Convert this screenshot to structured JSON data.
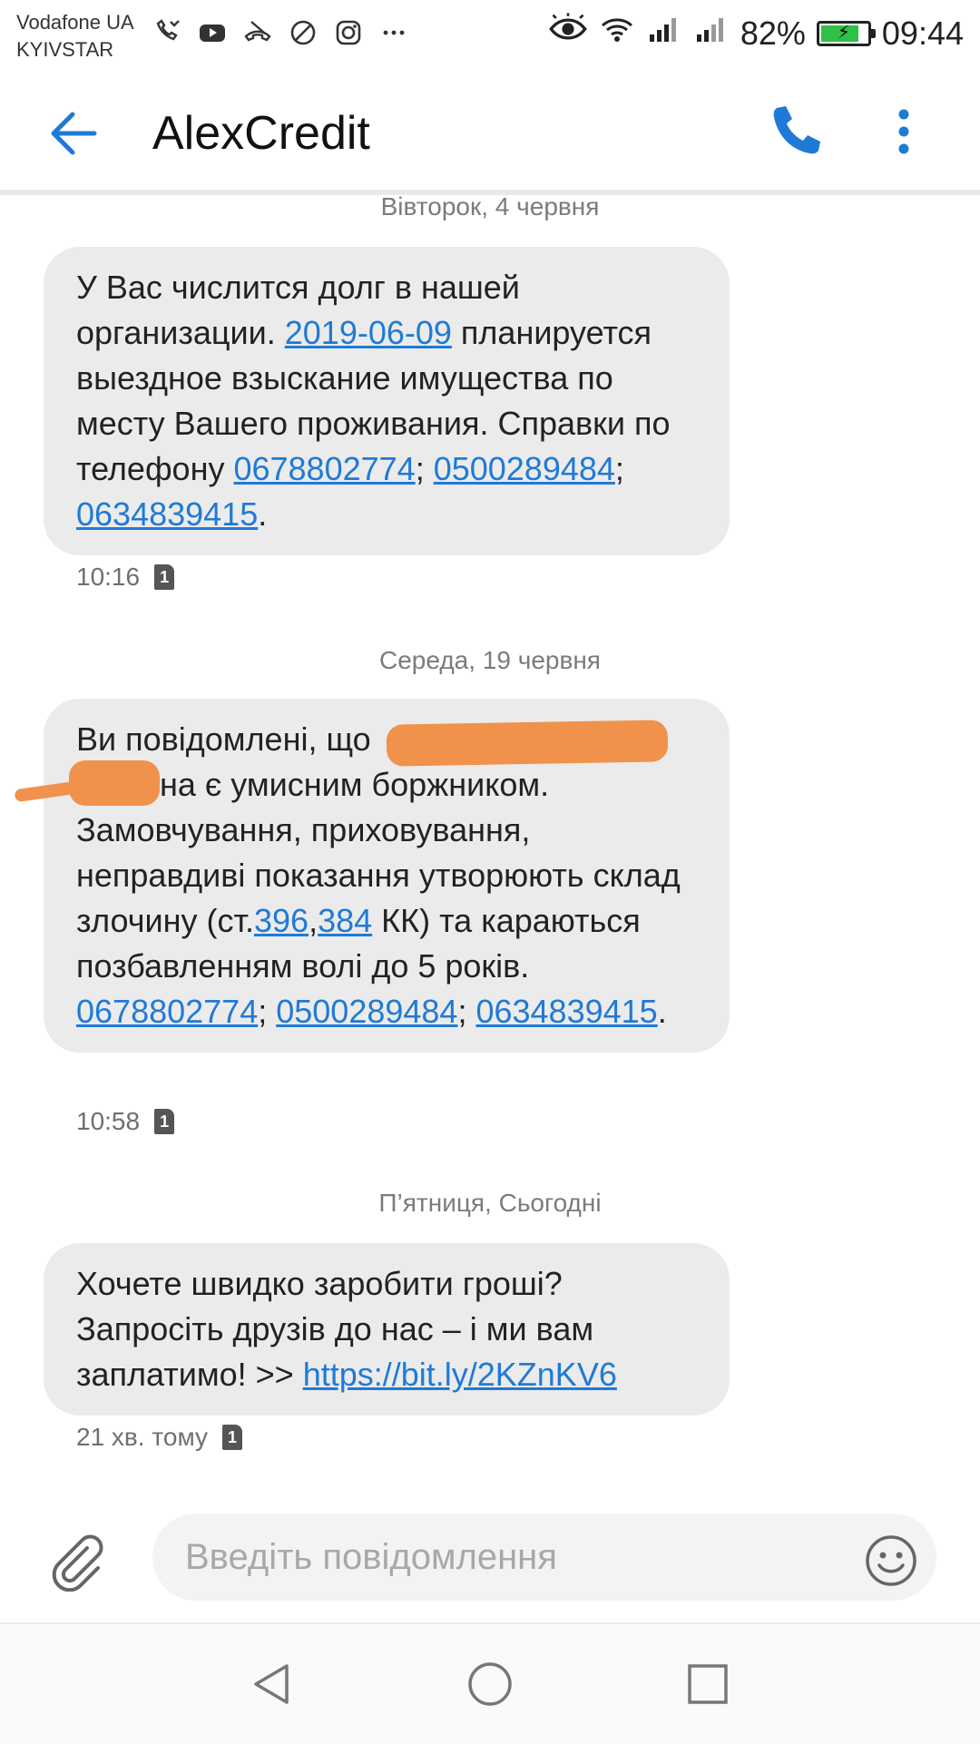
{
  "status_bar": {
    "carrier_1": "Vodafone UA",
    "carrier_2": "KYIVSTAR",
    "icons_left": [
      "missed-call-icon",
      "youtube-icon",
      "call-end-icon",
      "blocked-icon",
      "instagram-icon",
      "more-dots-icon"
    ],
    "icons_right": [
      "eye-icon",
      "wifi-icon",
      "signal-icon",
      "signal-icon"
    ],
    "battery": "82%",
    "battery_level": 0.82,
    "time": "09:44"
  },
  "header": {
    "title": "AlexCredit"
  },
  "messages": [
    {
      "date": "Вівторок, 4 червня",
      "text_parts": [
        "У Вас числится долг в нашей организации. ",
        "2019-06-09",
        " планируется выездное взыскание имущества по месту Вашего проживания. Справки по телефону ",
        "0678802774",
        "; ",
        "0500289484",
        "; ",
        "0634839415",
        "."
      ],
      "time": "10:16",
      "sim": "1"
    },
    {
      "date": "Середа, 19 червня",
      "text_parts": [
        "Ви повідомлені, що",
        "на є умисним боржником. Замовчування, приховування, неправдиві показання утворюють склад злочину (ст.",
        "396",
        ",",
        "384",
        " КК) та караються позбавленням волі до 5 років. ",
        "0678802774",
        "; ",
        "0500289484",
        "; ",
        "0634839415",
        "."
      ],
      "time": "10:58",
      "sim": "1"
    },
    {
      "date": "П’ятниця, Сьогодні",
      "text_parts": [
        "Хочете швидко заробити гроші? Запросіть друзів до нас – і ми вам заплатимо!  >> ",
        "https://bit.ly/2KZnKV6"
      ],
      "time": "21 хв. тому",
      "sim": "1"
    }
  ],
  "composer": {
    "placeholder": "Введіть повідомлення"
  },
  "colors": {
    "accent": "#1f7ad6",
    "bubble": "#ebebeb",
    "redaction": "#f0924c",
    "battery": "#2fc046"
  }
}
